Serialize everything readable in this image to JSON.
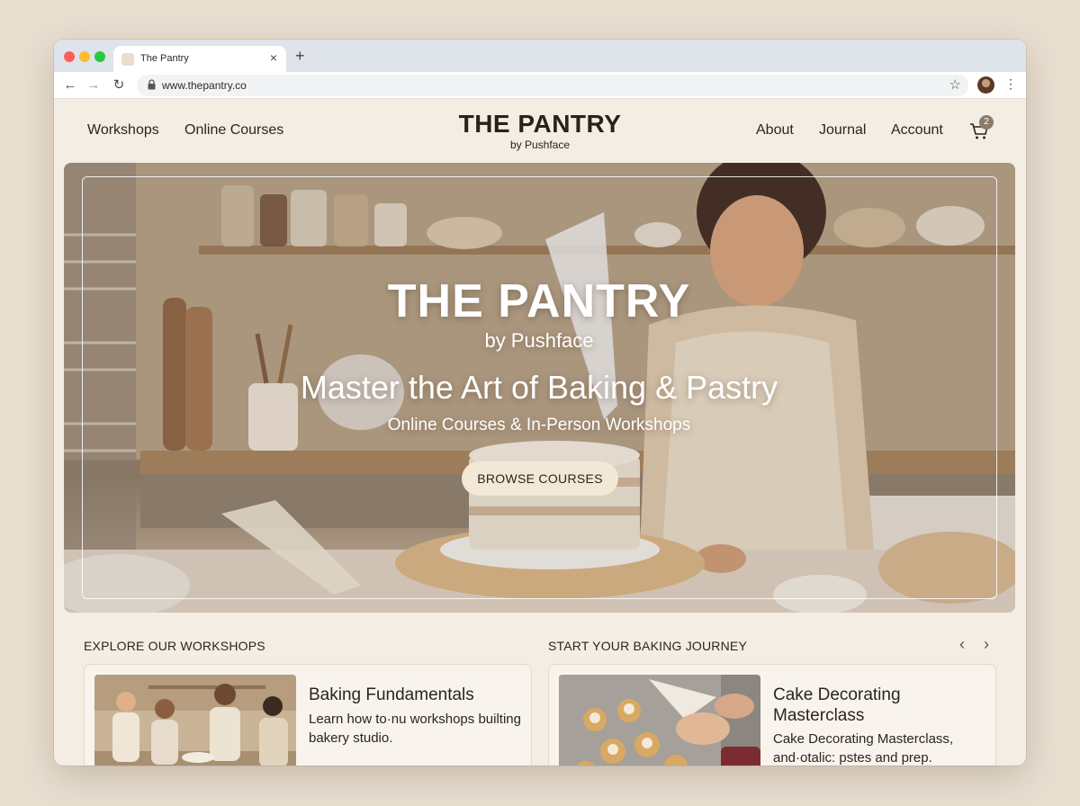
{
  "browser": {
    "tab_title": "The Pantry",
    "url": "www.thepantry.co",
    "icons": [
      "back-icon",
      "forward-icon",
      "reload-icon",
      "lock-icon",
      "star-icon",
      "menu-icon"
    ]
  },
  "header": {
    "nav_left": [
      "Workshops",
      "Online Courses"
    ],
    "brand_name": "THE PANTRY",
    "brand_sub": "by Pushface",
    "nav_right": [
      "About",
      "Journal",
      "Account"
    ],
    "cart_count": "2"
  },
  "hero": {
    "title": "THE PANTRY",
    "by": "by Pushface",
    "headline": "Master the Art of Baking & Pastry",
    "subheadline": "Online Courses & In-Person Workshops",
    "cta": "BROWSE COURSES"
  },
  "sections": {
    "workshops_title": "EXPLORE OUR WORKSHOPS",
    "journey_title": "START YOUR BAKING JOURNEY"
  },
  "cards": [
    {
      "title": "Baking Fundamentals",
      "description": "Learn how to·nu workshops builting bakery studio."
    },
    {
      "title": "Cake Decorating Masterclass",
      "description": "Cake Decorating Masterclass, and·otalic: pstes and prep."
    }
  ],
  "colors": {
    "background": "#e9dfd1",
    "page": "#f4ede3",
    "button": "#f3e7d6",
    "badge": "#8d7b6a"
  }
}
